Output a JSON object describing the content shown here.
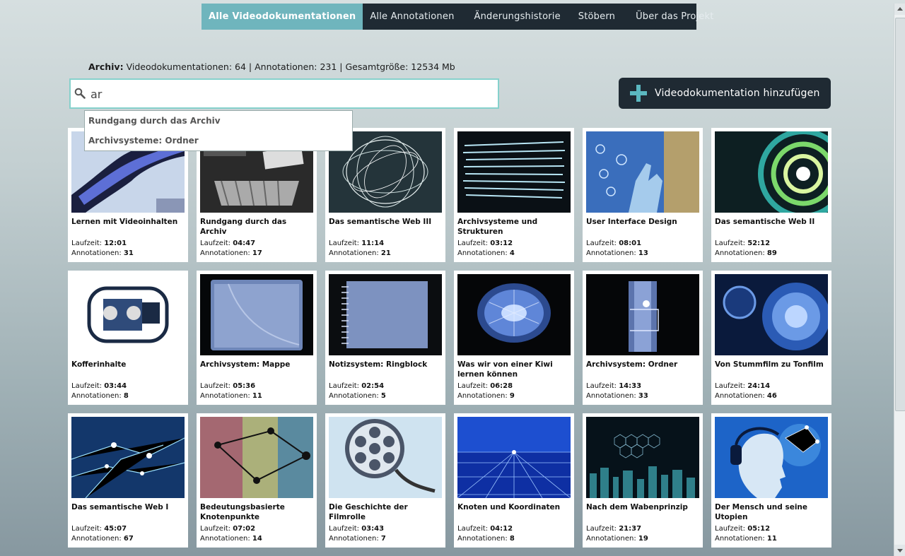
{
  "nav": {
    "items": [
      {
        "label": "Alle Videodokumentationen",
        "active": true
      },
      {
        "label": "Alle Annotationen",
        "active": false
      },
      {
        "label": "Änderungshistorie",
        "active": false
      },
      {
        "label": "Stöbern",
        "active": false
      },
      {
        "label": "Über das Projekt",
        "active": false
      }
    ]
  },
  "stats": {
    "label": "Archiv:",
    "text": " Videodokumentationen: 64 | Annotationen: 231 | Gesamtgröße: 12534 Mb"
  },
  "search": {
    "value": "ar",
    "suggestions": [
      "Rundgang durch das Archiv",
      "Archivsysteme: Ordner"
    ]
  },
  "add_button": {
    "label": "Videodokumentation hinzufügen"
  },
  "meta_labels": {
    "duration": "Laufzeit: ",
    "annotations": "Annotationen: "
  },
  "colors": {
    "accent": "#6fb5bd",
    "nav_bg": "#1f2a33",
    "search_border": "#86d1cc"
  },
  "videos": [
    {
      "title": "Lernen mit Videoinhalten",
      "duration": "12:01",
      "annotations": "31",
      "thumb": "film-strip-puzzle"
    },
    {
      "title": "Rundgang durch das Archiv",
      "duration": "04:47",
      "annotations": "17",
      "thumb": "typewriter-files"
    },
    {
      "title": "Das semantische Web III",
      "duration": "11:14",
      "annotations": "21",
      "thumb": "wire-sphere"
    },
    {
      "title": "Archivsysteme und Strukturen",
      "duration": "03:12",
      "annotations": "4",
      "thumb": "paper-stack"
    },
    {
      "title": "User Interface Design",
      "duration": "08:01",
      "annotations": "13",
      "thumb": "touch-hand"
    },
    {
      "title": "Das semantische Web II",
      "duration": "52:12",
      "annotations": "89",
      "thumb": "light-tunnel"
    },
    {
      "title": "Kofferinhalte",
      "duration": "03:44",
      "annotations": "8",
      "thumb": "xray-projector"
    },
    {
      "title": "Archivsystem: Mappe",
      "duration": "05:36",
      "annotations": "11",
      "thumb": "xray-folder"
    },
    {
      "title": "Notizsystem: Ringblock",
      "duration": "02:54",
      "annotations": "5",
      "thumb": "xray-notepad"
    },
    {
      "title": "Was wir von einer Kiwi lernen können",
      "duration": "06:28",
      "annotations": "9",
      "thumb": "xray-kiwi"
    },
    {
      "title": "Archivsystem: Ordner",
      "duration": "14:33",
      "annotations": "33",
      "thumb": "xray-binder"
    },
    {
      "title": "Von Stummfilm zu Tonfilm",
      "duration": "24:14",
      "annotations": "46",
      "thumb": "speaker"
    },
    {
      "title": "Das semantische Web I",
      "duration": "45:07",
      "annotations": "67",
      "thumb": "network-lines"
    },
    {
      "title": "Bedeutungsbasierte Knotenpunkte",
      "duration": "07:02",
      "annotations": "14",
      "thumb": "colorful-nodes"
    },
    {
      "title": "Die Geschichte der Filmrolle",
      "duration": "03:43",
      "annotations": "7",
      "thumb": "film-reel"
    },
    {
      "title": "Knoten und Koordinaten",
      "duration": "04:12",
      "annotations": "8",
      "thumb": "blue-grid"
    },
    {
      "title": "Nach dem Wabenprinzip",
      "duration": "21:37",
      "annotations": "19",
      "thumb": "honeycomb-city"
    },
    {
      "title": "Der Mensch und seine Utopien",
      "duration": "05:12",
      "annotations": "11",
      "thumb": "headphones-woman"
    }
  ]
}
